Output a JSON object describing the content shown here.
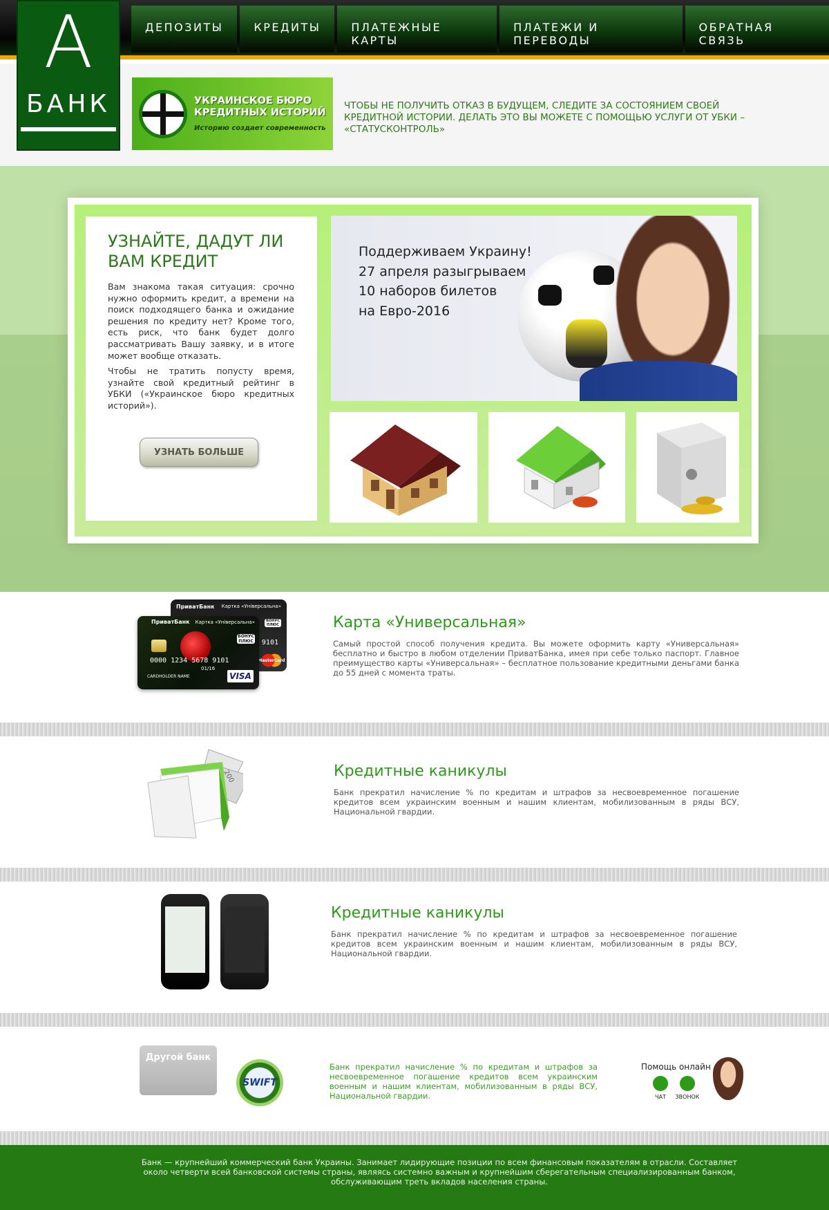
{
  "logo": {
    "letter": "А",
    "word": "БАНК"
  },
  "nav": [
    {
      "label": "ДЕПОЗИТЫ"
    },
    {
      "label": "КРЕДИТЫ"
    },
    {
      "label": "ПЛАТЕЖНЫЕ КАРТЫ"
    },
    {
      "label": "ПЛАТЕЖИ И ПЕРЕВОДЫ"
    },
    {
      "label": "ОБРАТНАЯ СВЯЗЬ"
    }
  ],
  "ubki": {
    "title": "УКРАИНСКОЕ БЮРО КРЕДИТНЫХ ИСТОРИЙ",
    "slogan": "Историю создает современность"
  },
  "promo_text": "ЧТОБЫ НЕ ПОЛУЧИТЬ ОТКАЗ В БУДУЩЕМ, СЛЕДИТЕ ЗА СОСТОЯНИЕМ СВОЕЙ КРЕДИТНОЙ ИСТОРИИ. ДЕЛАТЬ ЭТО ВЫ МОЖЕТЕ С ПОМОЩЬЮ УСЛУГИ ОТ УБКИ – «СТАТУСКОНТРОЛЬ»",
  "info": {
    "title": "УЗНАЙТЕ, ДАДУТ ЛИ ВАМ КРЕДИТ",
    "p1": "Вам знакома такая ситуация: срочно нужно оформить кредит, а времени на поиск подходящего банка и ожидание решения по кредиту нет? Кроме того, есть риск, что банк будет долго рассматривать Вашу заявку, и в итоге может вообще отказать.",
    "p2": "Чтобы не тратить попусту время, узнайте свой кредитный рейтинг в УБКИ («Украинское бюро кредитных историй»).",
    "button": "УЗНАТЬ БОЛЬШЕ"
  },
  "banner": {
    "line1": "Поддерживаем Украину!",
    "line2": "27 апреля разыгрываем",
    "line3": "10 наборов билетов",
    "line4": "на Евро-2016"
  },
  "cards_image": {
    "bank": "ПриватБанк",
    "card_label": "Картка «Універсальна»",
    "number": "0000 1234 5678 9101",
    "back_number": "9101",
    "expiry": "01/16",
    "holder": "CARDHOLDER NAME",
    "bonus": "БОНУС ПЛЮС",
    "visa": "VISA",
    "mastercard": "MasterCard"
  },
  "calendar_image": {
    "note_value": "200"
  },
  "sections": [
    {
      "title": "Карта «Универсальная»",
      "text": "Самый простой способ получения кредита. Вы можете оформить карту «Универсальная» бесплатно и быстро в любом отделении ПриватБанка, имея при себе только паспорт. Главное преимущество карты «Универсальная» – бесплатное пользование кредитными деньгами банка до 55 дней с момента траты."
    },
    {
      "title": "Кредитные каникулы",
      "text": "Банк прекратил начисление % по кредитам и штрафов за несвоевременное погашение кредитов всем украинским военным и нашим клиентам, мобилизованным в ряды ВСУ, Национальной гвардии."
    },
    {
      "title": "Кредитные каникулы",
      "text": "Банк прекратил начисление % по кредитам и штрафов за несвоевременное погашение кредитов всем украинским военным и нашим клиентам, мобилизованным в ряды ВСУ, Национальной гвардии."
    }
  ],
  "bottom": {
    "other_bank": "Другой банк",
    "swift": "SWIFT",
    "text": "Банк прекратил начисление % по кредитам и штрафов за несвоевременное погашение кредитов всем украинским военным и нашим клиентам, мобилизованным в ряды ВСУ, Национальной гвардии.",
    "help_title": "Помощь онлайн",
    "chat": "ЧАТ",
    "call": "ЗВОНОК"
  },
  "footer": {
    "text": "Банк — крупнейший коммерческий банк Украины. Занимает лидирующие позиции по всем финансовым показателям в отрасли. Составляет около четверти всей банковской системы страны, являясь системно важным и крупнейшим сберегательным специализированным банком, обслуживающим треть вкладов населения страны."
  },
  "colors": {
    "brand_green": "#0a5a12",
    "accent_orange": "#f0a800",
    "title_green": "#2e9a1a",
    "footer_green": "#257a14"
  }
}
